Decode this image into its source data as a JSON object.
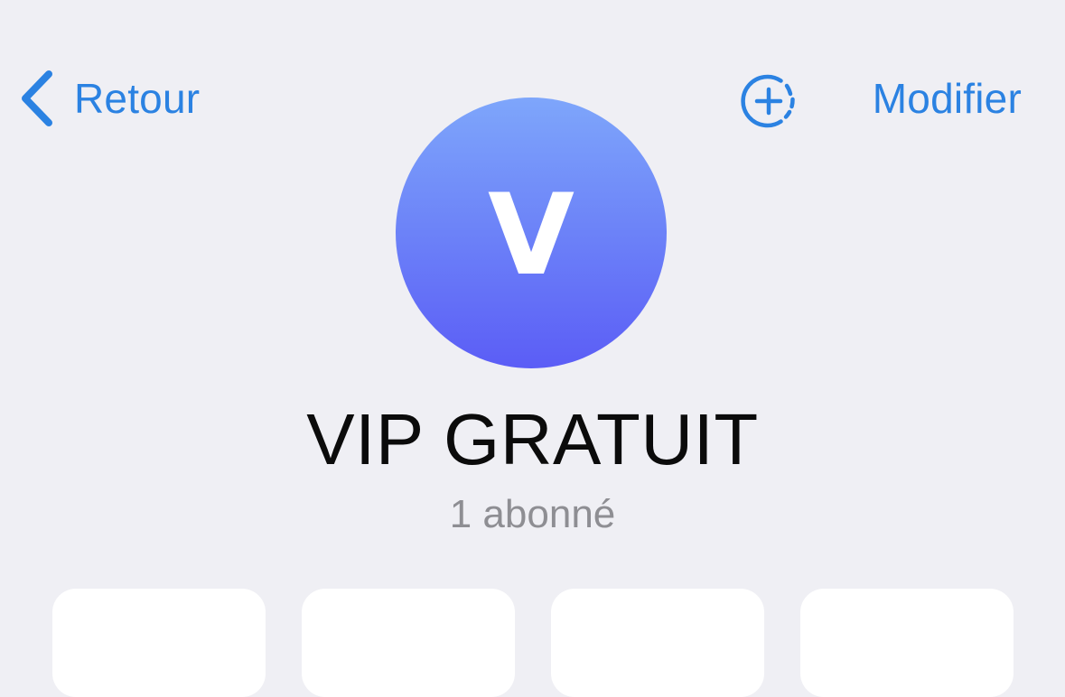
{
  "nav": {
    "back_label": "Retour",
    "edit_label": "Modifier"
  },
  "channel": {
    "avatar_letter": "V",
    "name": "VIP GRATUIT",
    "subscribers": "1 abonné"
  },
  "colors": {
    "accent": "#2b82e2",
    "background": "#efeff4",
    "avatar_gradient_top": "#7ea6fb",
    "avatar_gradient_bottom": "#5b5df6",
    "subtitle": "#8e8e93"
  },
  "icons": {
    "back": "chevron-left-icon",
    "story": "add-story-icon"
  }
}
